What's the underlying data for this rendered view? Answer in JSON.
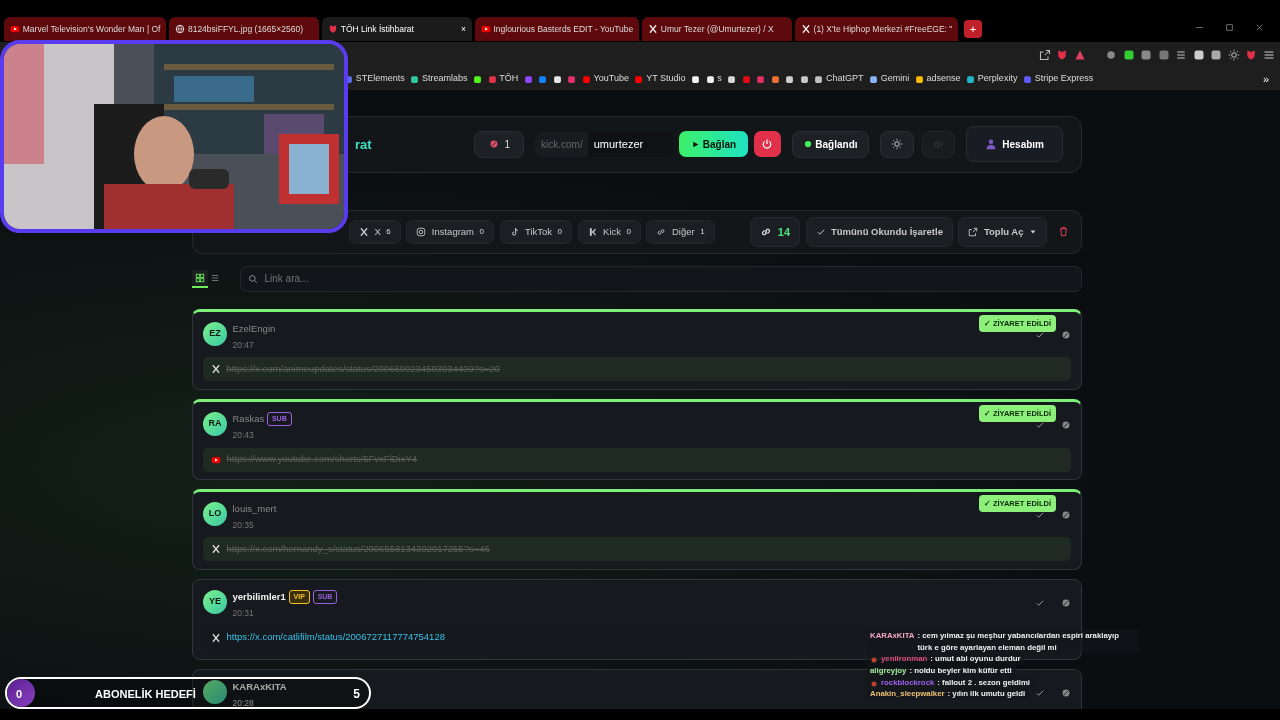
{
  "browser": {
    "tabs": [
      {
        "title": "Marvel Television's Wonder Man | Of",
        "kind": "youtube",
        "selected": false
      },
      {
        "title": "8124bsiFFYL.jpg (1665×2560)",
        "kind": "globe",
        "selected": false
      },
      {
        "title": "TÖH Link İstihbarat",
        "kind": "shield",
        "selected": true
      },
      {
        "title": "Inglourious Basterds EDIT - YouTube",
        "kind": "youtube",
        "selected": false
      },
      {
        "title": "Umur Tezer (@Umurtezer) / X",
        "kind": "x",
        "selected": false
      },
      {
        "title": "(1) X'te Hiphop Merkezi #FreeEGE: \"",
        "kind": "x",
        "selected": false
      }
    ],
    "new_tab": "+",
    "close_tab": "×",
    "bookmarks": [
      {
        "label": "STElements",
        "color": "#5b6cf0"
      },
      {
        "label": "Streamlabs",
        "color": "#30c8a0"
      },
      {
        "color": "#53fc18"
      },
      {
        "label": "TÖH",
        "color": "#e0304a"
      },
      {
        "color": "#9146ff"
      },
      {
        "color": "#1185fe"
      },
      {
        "color": "#e8e8e8"
      },
      {
        "color": "#e1306c"
      },
      {
        "label": "YouTube",
        "color": "#ff0000"
      },
      {
        "label": "YT Studio",
        "color": "#ff0000"
      },
      {
        "color": "#f0f0f0"
      },
      {
        "label": "s",
        "color": "#f0f0f0"
      },
      {
        "color": "#d8d8d8"
      },
      {
        "color": "#e50914"
      },
      {
        "color": "#e03060"
      },
      {
        "color": "#f07030"
      },
      {
        "color": "#d0d0d0"
      },
      {
        "color": "#c8c8c8"
      },
      {
        "label": "ChatGPT",
        "color": "#c0c0c0"
      },
      {
        "label": "Gemini",
        "color": "#8ab4f8"
      },
      {
        "label": "adsense",
        "color": "#fbbc04"
      },
      {
        "label": "Perplexity",
        "color": "#20b8c8"
      },
      {
        "label": "Stripe Express",
        "color": "#635bff"
      }
    ],
    "more": "»"
  },
  "header": {
    "title": "rat",
    "blocked_count": "1",
    "channel_prefix": "kick.com/",
    "channel": "umurtezer",
    "connect_label": "Bağlan",
    "status": "Bağlandı",
    "connected": true,
    "mute_disabled": true,
    "account": "Hesabım"
  },
  "filters": [
    {
      "kind": "x",
      "label": "X",
      "count": "6"
    },
    {
      "kind": "instagram",
      "label": "Instagram",
      "count": "0"
    },
    {
      "kind": "tiktok",
      "label": "TikTok",
      "count": "0"
    },
    {
      "kind": "kick",
      "label": "Kick",
      "count": "0"
    },
    {
      "kind": "link",
      "label": "Diğer",
      "count": "1"
    }
  ],
  "link_count": "14",
  "mark_all": "Tümünü Okundu İşaretle",
  "bulk_open": "Toplu Aç",
  "views": [
    {
      "kind": "grid",
      "selected": true
    },
    {
      "kind": "list",
      "selected": false
    }
  ],
  "search": {
    "placeholder": "Link ara..."
  },
  "links": [
    {
      "initials": "EZ",
      "user": "EzelEngin",
      "time": "20:47",
      "kind": "x",
      "url": "https://x.com/animeupdates/status/2006690234503934409?s=20",
      "visited": true,
      "visited_label": "✓ ZİYARET EDİLDİ"
    },
    {
      "initials": "RA",
      "user": "Raskas",
      "time": "20:43",
      "badges": [
        {
          "kind": "sub",
          "label": "SUB"
        }
      ],
      "kind": "youtube",
      "url": "https://www.youtube.com/shorts/5FvxFlDixY4",
      "visited": true,
      "visited_label": "✓ ZİYARET EDİLDİ"
    },
    {
      "initials": "LO",
      "user": "louis_mert",
      "time": "20:35",
      "kind": "x",
      "url": "https://x.com/hernandy_s/status/2006558134392017255?s=46",
      "visited": true,
      "visited_label": "✓ ZİYARET EDİLDİ"
    },
    {
      "initials": "YE",
      "user": "yerbilimler1",
      "time": "20:31",
      "badges": [
        {
          "kind": "vip",
          "label": "VIP"
        },
        {
          "kind": "sub",
          "label": "SUB"
        }
      ],
      "kind": "x",
      "url": "https://x.com/catlifilm/status/2006727117774754128",
      "visited": false
    },
    {
      "user": "KARAxKITA",
      "time": "20:28",
      "visited": false
    }
  ],
  "goal": {
    "current": "0",
    "label": "ABONELİK HEDEFİ",
    "target": "5",
    "level": 0
  },
  "chat": [
    {
      "user": "KARAxKITA",
      "color": "#f2a7c3",
      "text": ": cem yılmaz şu meşhur yabancılardan espiri araklayıp türk e göre ayarlayan eleman değil mi"
    },
    {
      "user": "yeniironman",
      "color": "#e0507a",
      "text": ": umut abi oyunu durdur",
      "icon": true
    },
    {
      "user": "aligreyjoy",
      "color": "#a3e89a",
      "text": ": noldu beyler kim küfür etti"
    },
    {
      "user": "rockblockrock",
      "color": "#a060f0",
      "text": ": fallout 2 . sezon geldimi",
      "icon": true
    },
    {
      "user": "Anakin_sleepwalker",
      "color": "#f0c070",
      "text": ": yılın ilk umutu geldi"
    }
  ]
}
